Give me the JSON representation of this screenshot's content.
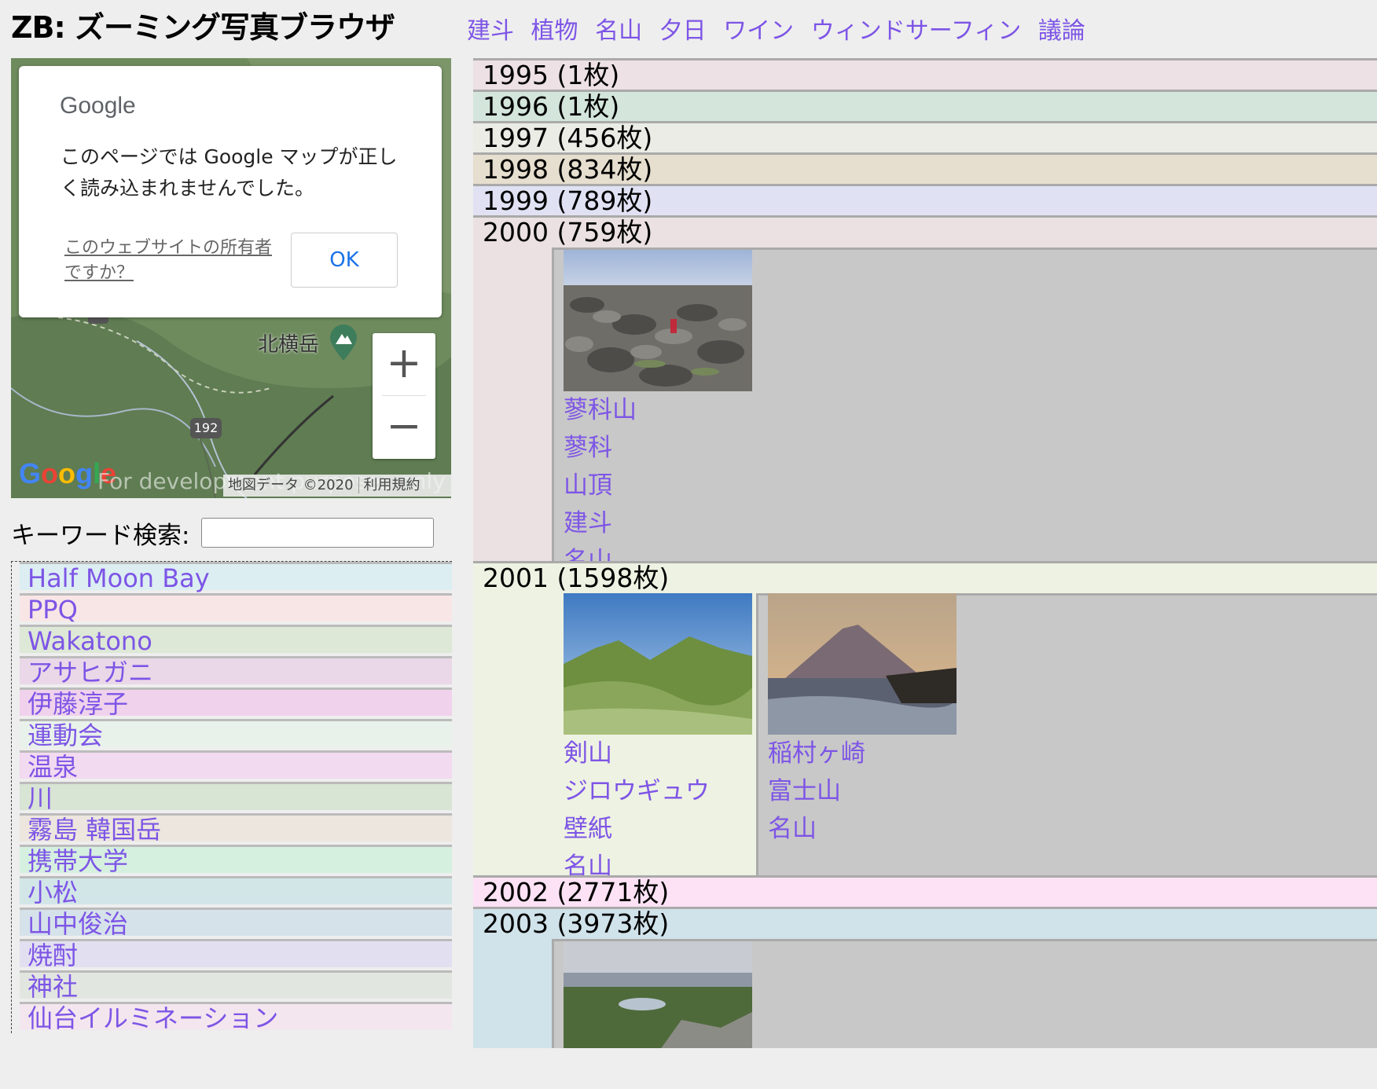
{
  "header": {
    "title": "ZB: ズーミング写真ブラウザ",
    "nav": [
      "建斗",
      "植物",
      "名山",
      "夕日",
      "ワイン",
      "ウィンドサーフィン",
      "議論"
    ]
  },
  "map": {
    "dialog": {
      "logo": "Google",
      "message": "このページでは Google マップが正しく読み込まれませんでした。",
      "owner_link": "このウェブサイトの所有者ですか？",
      "ok_label": "OK"
    },
    "zoom_in": "+",
    "zoom_out": "−",
    "peak_label": "北横岳",
    "road_number": "192",
    "google_logo": "Google",
    "watermark": "For development purposes only",
    "attribution": "地図データ ©2020",
    "terms": "利用規約"
  },
  "search": {
    "label": "キーワード検索:",
    "value": "",
    "placeholder": ""
  },
  "keywords": [
    {
      "label": "Half Moon Bay",
      "color": "#dceef2"
    },
    {
      "label": "PPQ",
      "color": "#f8e6e6"
    },
    {
      "label": "Wakatono",
      "color": "#dde8d6"
    },
    {
      "label": "アサヒガニ",
      "color": "#ead8e8"
    },
    {
      "label": "伊藤淳子",
      "color": "#f0d2ec"
    },
    {
      "label": "運動会",
      "color": "#e8f2ea"
    },
    {
      "label": "温泉",
      "color": "#f2daf0"
    },
    {
      "label": "川",
      "color": "#d8e4d4"
    },
    {
      "label": "霧島 韓国岳",
      "color": "#ece6de"
    },
    {
      "label": "携帯大学",
      "color": "#d6f0e0"
    },
    {
      "label": "小松",
      "color": "#d2e6e8"
    },
    {
      "label": "山中俊治",
      "color": "#d6e2ea"
    },
    {
      "label": "焼酎",
      "color": "#e2e0f0"
    },
    {
      "label": "神社",
      "color": "#e2e6e0"
    },
    {
      "label": "仙台イルミネーション",
      "color": "#f4e6ee"
    }
  ],
  "years": [
    {
      "label": "1995 (1枚)",
      "color": "#ede1e6"
    },
    {
      "label": "1996 (1枚)",
      "color": "#d4e6dc"
    },
    {
      "label": "1997 (456枚)",
      "color": "#ecece6"
    },
    {
      "label": "1998 (834枚)",
      "color": "#e6dece"
    },
    {
      "label": "1999 (789枚)",
      "color": "#e0e2f4"
    },
    {
      "label": "2000 (759枚)",
      "color": "#ebe1e2"
    },
    {
      "label": "2001 (1598枚)",
      "color": "#eef2e2"
    },
    {
      "label": "2002 (2771枚)",
      "color": "#fce2f4"
    },
    {
      "label": "2003 (3973枚)",
      "color": "#d0e2ea"
    }
  ],
  "photos": {
    "y2000": [
      {
        "name": "rocky-summit-photo",
        "tags": [
          "蓼科山",
          "蓼科",
          "山頂",
          "建斗",
          "名山"
        ]
      }
    ],
    "y2001": [
      {
        "name": "green-ridge-photo",
        "tags": [
          "剣山",
          "ジロウギュウ",
          "壁紙",
          "名山"
        ]
      },
      {
        "name": "mt-fuji-sunset-photo",
        "tags": [
          "稲村ヶ崎",
          "富士山",
          "名山"
        ]
      }
    ],
    "y2003": [
      {
        "name": "crater-lake-photo",
        "tags": []
      }
    ]
  }
}
